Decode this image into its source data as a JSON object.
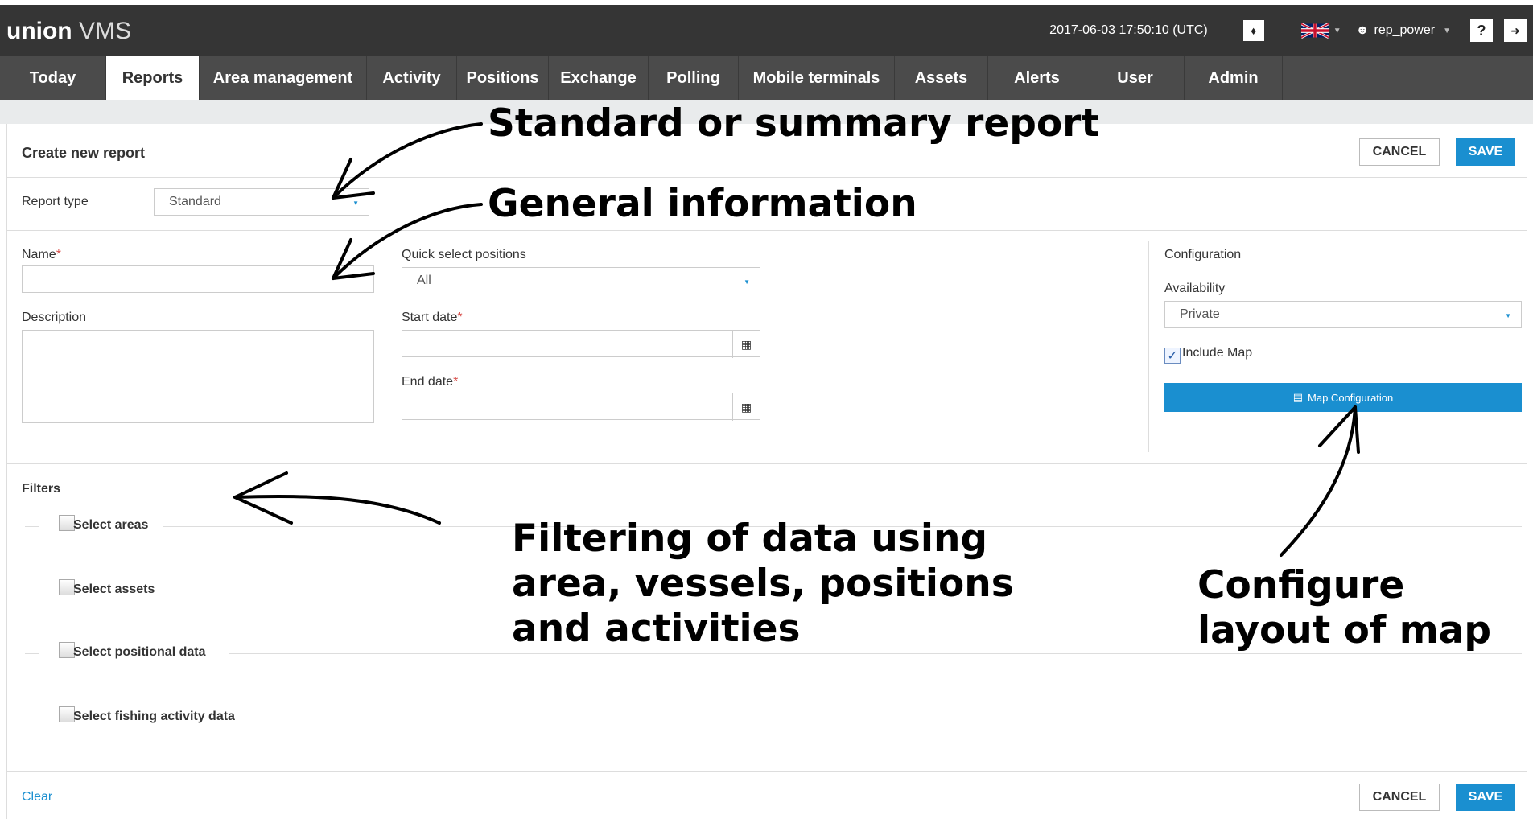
{
  "app": {
    "logo_bold": "union",
    "logo_light": "VMS",
    "timestamp": "2017-06-03 17:50:10 (UTC)",
    "username": "rep_power",
    "help_label": "?"
  },
  "nav": {
    "tabs": [
      {
        "label": "Today"
      },
      {
        "label": "Reports"
      },
      {
        "label": "Area management"
      },
      {
        "label": "Activity"
      },
      {
        "label": "Positions"
      },
      {
        "label": "Exchange"
      },
      {
        "label": "Polling"
      },
      {
        "label": "Mobile terminals"
      },
      {
        "label": "Assets"
      },
      {
        "label": "Alerts"
      },
      {
        "label": "User"
      },
      {
        "label": "Admin"
      }
    ],
    "active": "Reports"
  },
  "form": {
    "title": "Create new report",
    "cancel_label": "CANCEL",
    "save_label": "SAVE",
    "report_type_label": "Report type",
    "report_type_value": "Standard",
    "name_label": "Name",
    "required_mark": "*",
    "description_label": "Description",
    "quick_select_label": "Quick select positions",
    "quick_select_value": "All",
    "start_date_label": "Start date",
    "end_date_label": "End date",
    "configuration_label": "Configuration",
    "availability_label": "Availability",
    "availability_value": "Private",
    "include_map_label": "Include Map",
    "include_map_checked": true,
    "map_config_label": "Map Configuration",
    "filters_label": "Filters",
    "filters": [
      {
        "label": "Select areas",
        "checked": false
      },
      {
        "label": "Select assets",
        "checked": false
      },
      {
        "label": "Select positional data",
        "checked": false
      },
      {
        "label": "Select fishing activity data",
        "checked": false
      }
    ],
    "clear_label": "Clear"
  },
  "annotations": {
    "report_type": "Standard or summary report",
    "general": "General information",
    "filters_line1": "Filtering of data using",
    "filters_line2": "area, vessels, positions",
    "filters_line3": "and activities",
    "map_line1": "Configure",
    "map_line2": "layout of map"
  },
  "colors": {
    "topbar": "#353535",
    "nav": "#4b4b4b",
    "accent": "#1a8fd0",
    "required": "#d9534f"
  }
}
